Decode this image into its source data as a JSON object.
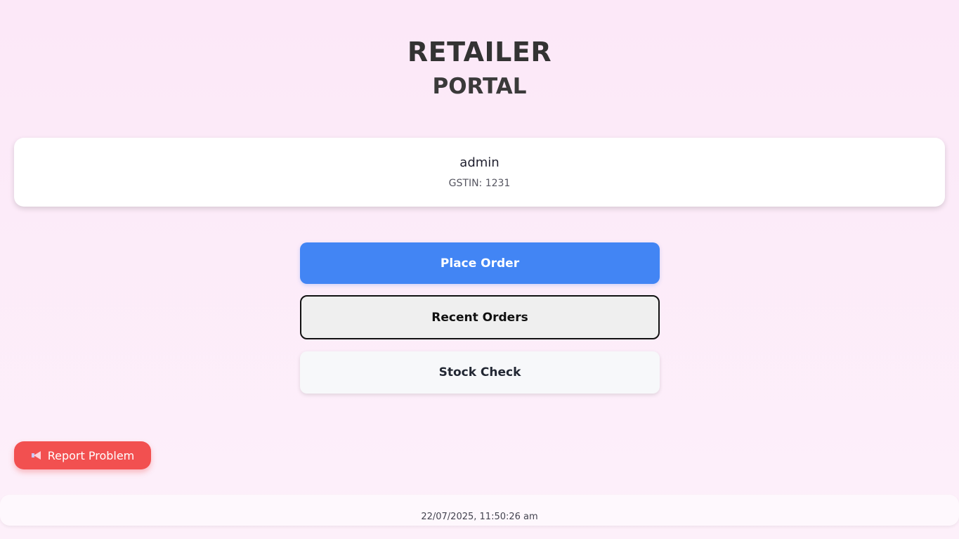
{
  "header": {
    "title": "RETAILER",
    "subtitle": "PORTAL"
  },
  "user": {
    "name": "admin",
    "gstin": "GSTIN: 1231"
  },
  "actions": {
    "place_order": "Place Order",
    "recent_orders": "Recent Orders",
    "stock_check": "Stock Check"
  },
  "report": {
    "icon": "megaphone-icon",
    "label": "Report Problem"
  },
  "footer": {
    "timestamp": "22/07/2025, 11:50:26 am"
  },
  "colors": {
    "primary": "#4285f4",
    "danger": "#f25050",
    "background": "#fce8f8"
  }
}
